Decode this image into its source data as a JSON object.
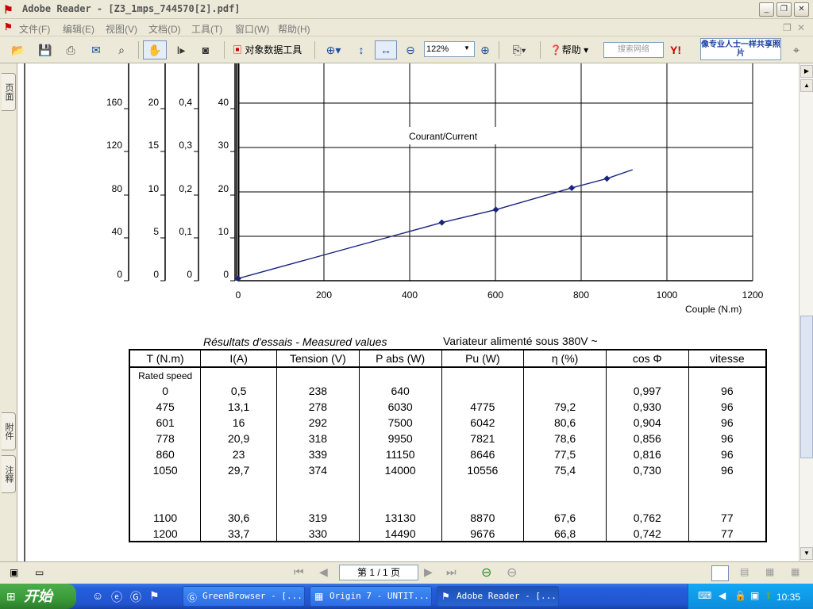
{
  "window": {
    "title": "Adobe Reader - [Z3_1mps_744570[2].pdf]"
  },
  "menu": [
    "文件(F)",
    "编辑(E)",
    "视图(V)",
    "文档(D)",
    "工具(T)",
    "窗口(W)",
    "帮助(H)"
  ],
  "toolbar": {
    "object_data_tool": "对象数据工具",
    "zoom": "122%",
    "help": "帮助",
    "search_placeholder": "搜索网络",
    "promo": "像专业人士一样共享照片"
  },
  "left_tabs": [
    "页面",
    "附件",
    "注释"
  ],
  "chart_data": {
    "type": "line",
    "xlabel": "Couple (N.m)",
    "x_ticks": [
      0,
      200,
      400,
      600,
      800,
      1000,
      1200
    ],
    "annotation": "Courant/Current",
    "left_axes": [
      {
        "ticks": [
          "0",
          "40",
          "80",
          "120",
          "160"
        ]
      },
      {
        "ticks": [
          "0",
          "5",
          "10",
          "15",
          "20"
        ]
      },
      {
        "ticks": [
          "0",
          "0,1",
          "0,2",
          "0,3",
          "0,4"
        ]
      },
      {
        "ticks": [
          "0",
          "10",
          "20",
          "30",
          "40"
        ]
      }
    ],
    "series": [
      {
        "x": [
          0,
          475,
          601,
          778,
          860,
          920
        ],
        "y": [
          0.5,
          13.1,
          16,
          20.9,
          23,
          25
        ]
      }
    ],
    "ylim": [
      0,
      50
    ],
    "xlim": [
      0,
      1200
    ],
    "grid": true,
    "line_color": "#1a237e"
  },
  "results": {
    "title": "Résultats d'essais - Measured values",
    "subtitle": "Variateur alimenté sous 380V ~",
    "headers": [
      "T (N.m)",
      "I(A)",
      "Tension (V)",
      "P abs (W)",
      "Pu (W)",
      "η (%)",
      "cos Φ",
      "vitesse"
    ],
    "rated_speed_label": "Rated speed",
    "rows": [
      [
        "0",
        "0,5",
        "238",
        "640",
        "",
        "",
        "0,997",
        "96"
      ],
      [
        "475",
        "13,1",
        "278",
        "6030",
        "4775",
        "79,2",
        "0,930",
        "96"
      ],
      [
        "601",
        "16",
        "292",
        "7500",
        "6042",
        "80,6",
        "0,904",
        "96"
      ],
      [
        "778",
        "20,9",
        "318",
        "9950",
        "7821",
        "78,6",
        "0,856",
        "96"
      ],
      [
        "860",
        "23",
        "339",
        "11150",
        "8646",
        "77,5",
        "0,816",
        "96"
      ],
      [
        "1050",
        "29,7",
        "374",
        "14000",
        "10556",
        "75,4",
        "0,730",
        "96"
      ],
      [
        "",
        "",
        "",
        "",
        "",
        "",
        "",
        ""
      ],
      [
        "",
        "",
        "",
        "",
        "",
        "",
        "",
        ""
      ],
      [
        "1100",
        "30,6",
        "319",
        "13130",
        "8870",
        "67,6",
        "0,762",
        "77"
      ],
      [
        "1200",
        "33,7",
        "330",
        "14490",
        "9676",
        "66,8",
        "0,742",
        "77"
      ]
    ]
  },
  "status": {
    "page": "第 1 / 1 页"
  },
  "taskbar": {
    "start": "开始",
    "tasks": [
      "GreenBrowser - [...",
      "Origin 7 - UNTIT...",
      "Adobe Reader - [..."
    ],
    "clock": "10:35"
  }
}
